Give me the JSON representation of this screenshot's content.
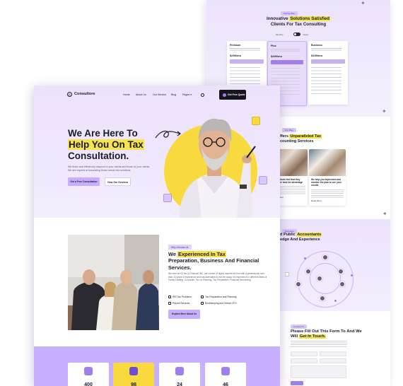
{
  "back_page": {
    "pricing": {
      "pill": "Pricing Plan",
      "title_pre": "Innovative ",
      "title_hl": "Solutions Satisfied",
      "title_post": "Clients For Tax Consulting",
      "toggle_left": "Monthly",
      "toggle_right": "Yearly",
      "plans": [
        {
          "name": "Premium",
          "price": "$299/mo"
        },
        {
          "name": "Plus",
          "price": "$499/mo"
        },
        {
          "name": "Business",
          "price": "$199/mo"
        }
      ]
    },
    "services": {
      "pill": "Our Blog",
      "title_pre": "ffers ",
      "title_hl": "Unparalleled Tax",
      "title_post": "counting Services",
      "cards": [
        {
          "text": "your clients feel that they have the best for advantage",
          "more": "Read More"
        },
        {
          "text": "We help you implement and monitor the plan to see your results",
          "more": "Read More"
        }
      ]
    },
    "team": {
      "pill": "Expertise",
      "title_pre": "d Public ",
      "title_hl": "Accountants",
      "title_post": "edge And Experience"
    },
    "form": {
      "pill": "Contact Us",
      "title_pre": "Please Fill Out This Form To And We Will ",
      "title_hl": "Get In Touch."
    }
  },
  "front_page": {
    "nav": {
      "logo": "Consultore",
      "logo_mark": "C",
      "items": [
        "Home",
        "About Us",
        "Our Service",
        "Blog",
        "Pages ▾"
      ],
      "cta": "Get Free Quote"
    },
    "hero": {
      "title_line1": "We Are Here To",
      "title_hl": "Help You On Tax",
      "title_line3": "Consultation.",
      "subtitle": "We listen and effectively respond to your needs and those of your clients. We are experts at translating those needs into solutions.",
      "btn_primary": "Get a Free Consultation",
      "btn_secondary": "View Our Services"
    },
    "about": {
      "pill": "Why Choose Us",
      "title_pre": "We ",
      "title_hl": "Experienced In Tax",
      "title_post": "Preparation, Business And Financial Services.",
      "paragraph": "We here at N3 Tax & Financial INC, are a team of highly experts tax firm with a professional over than 15 years of experience and has diversified to the fee today. It's experience in different fields of Family Dealing, Corporate, Tax on Planning, Tax Preparation, Financial Accounting.",
      "features": [
        "IRS Tax Problems",
        "Tax Preparation and Planning",
        "Payroll Services",
        "Bookkeeping and Virtual CFO"
      ],
      "button": "Explore More About Us"
    },
    "stats": [
      {
        "value": "400",
        "icon": "users-icon"
      },
      {
        "value": "98",
        "icon": "building-icon"
      },
      {
        "value": "24",
        "icon": "clock-icon"
      },
      {
        "value": "46",
        "icon": "thumbs-up-icon"
      }
    ]
  },
  "colors": {
    "lavender": "#ece3fb",
    "purple_accent": "#9f7ef0",
    "button_purple": "#c7afff",
    "yellow": "#f8da3e",
    "highlight": "#f7e34b",
    "dark": "#15141f"
  }
}
